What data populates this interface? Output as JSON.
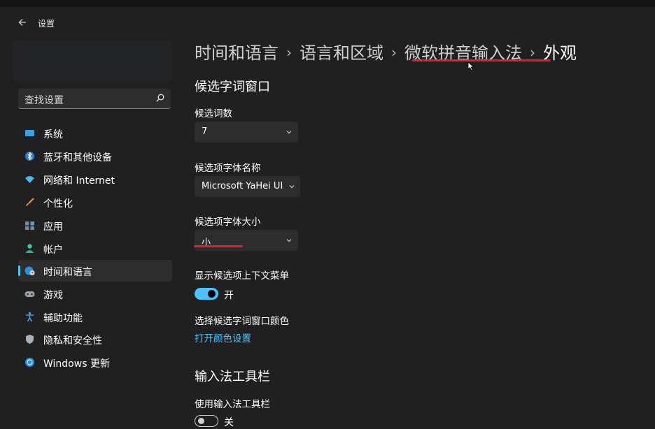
{
  "window": {
    "title": "设置"
  },
  "search": {
    "placeholder": "查找设置"
  },
  "sidebar": {
    "items": [
      {
        "label": "系统",
        "icon": "monitor-icon"
      },
      {
        "label": "蓝牙和其他设备",
        "icon": "bluetooth-icon"
      },
      {
        "label": "网络和 Internet",
        "icon": "wifi-icon"
      },
      {
        "label": "个性化",
        "icon": "brush-icon"
      },
      {
        "label": "应用",
        "icon": "apps-icon"
      },
      {
        "label": "帐户",
        "icon": "person-icon"
      },
      {
        "label": "时间和语言",
        "icon": "globe-clock-icon",
        "active": true
      },
      {
        "label": "游戏",
        "icon": "gamepad-icon"
      },
      {
        "label": "辅助功能",
        "icon": "accessibility-icon"
      },
      {
        "label": "隐私和安全性",
        "icon": "shield-icon"
      },
      {
        "label": "Windows 更新",
        "icon": "update-icon"
      }
    ]
  },
  "breadcrumb": [
    "时间和语言",
    "语言和区域",
    "微软拼音输入法",
    "外观"
  ],
  "candidate_window": {
    "title": "候选字词窗口",
    "count": {
      "label": "候选词数",
      "value": "7"
    },
    "font_name": {
      "label": "候选项字体名称",
      "value": "Microsoft YaHei UI"
    },
    "font_size": {
      "label": "候选项字体大小",
      "value": "小"
    },
    "context_menu": {
      "label": "显示候选项上下文菜单",
      "state": "开",
      "on": true
    },
    "color": {
      "label": "选择候选字词窗口颜色",
      "link": "打开颜色设置"
    }
  },
  "toolbar": {
    "title": "输入法工具栏",
    "use": {
      "label": "使用输入法工具栏",
      "state": "关",
      "on": false
    }
  },
  "colors": {
    "accent": "#4cc2ff",
    "highlight_underline": "#e0202a",
    "background": "#202020"
  }
}
